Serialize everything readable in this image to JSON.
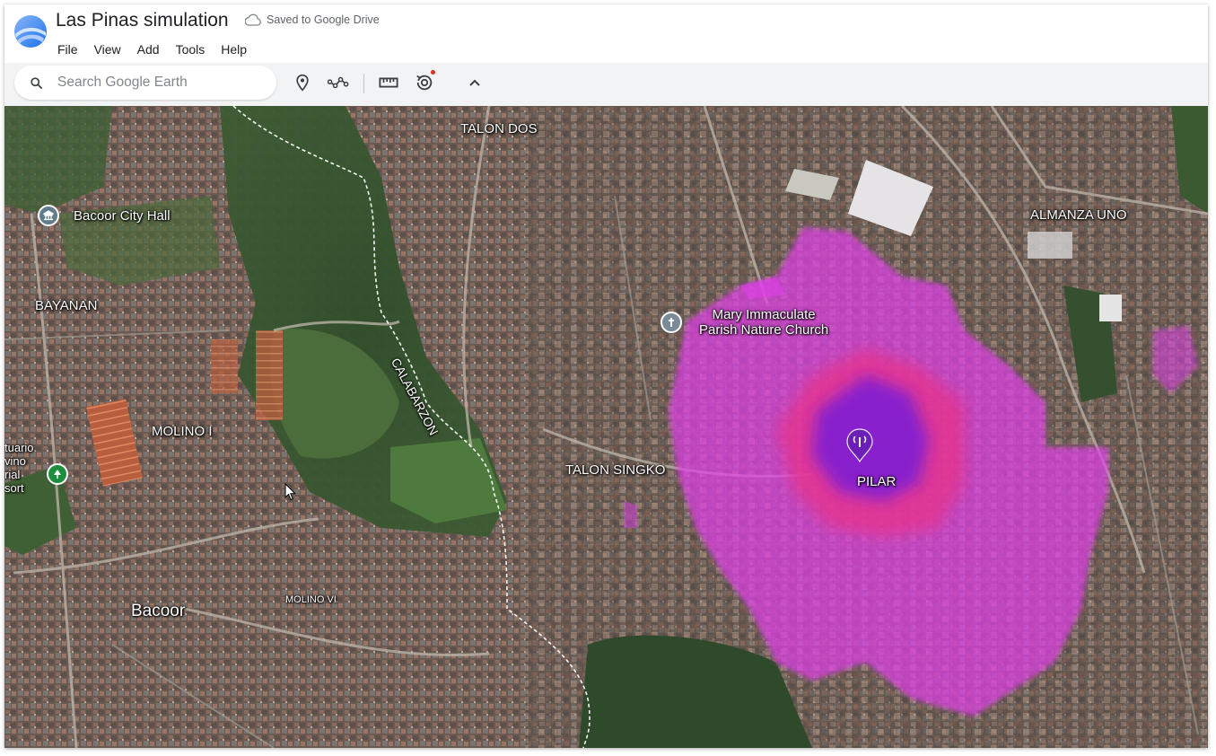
{
  "app": {
    "title": "Las Pinas simulation",
    "saved_status": "Saved to Google Drive"
  },
  "menu": {
    "items": [
      {
        "label": "File"
      },
      {
        "label": "View"
      },
      {
        "label": "Add"
      },
      {
        "label": "Tools"
      },
      {
        "label": "Help"
      }
    ]
  },
  "search": {
    "placeholder": "Search Google Earth"
  },
  "toolbar_icons": [
    "placemark-icon",
    "path-icon",
    "ruler-icon",
    "voyager-icon",
    "chevron-up-icon"
  ],
  "map": {
    "labels": {
      "talon_dos": "TALON DOS",
      "almanza_uno": "ALMANZA UNO",
      "bacoor_city_hall": "Bacoor City Hall",
      "bayanan": "BAYANAN",
      "mary_immaculate": "Mary Immaculate\nParish Nature Church",
      "calabarzon": "CALABARZON",
      "molino_i": "MOLINO I",
      "talon_singko": "TALON SINGKO",
      "pilar": "PILAR",
      "bacoor": "Bacoor",
      "molino_vi": "MOLINO VI",
      "partial_left": "tuario\nvino\nrial\nsort"
    },
    "coverage_colors": {
      "outer": "#e040e8",
      "middle": "#e8308a",
      "inner": "#7a1fd6"
    },
    "icons": [
      "city-hall-icon",
      "church-icon",
      "park-icon",
      "antenna-tower-icon"
    ]
  }
}
